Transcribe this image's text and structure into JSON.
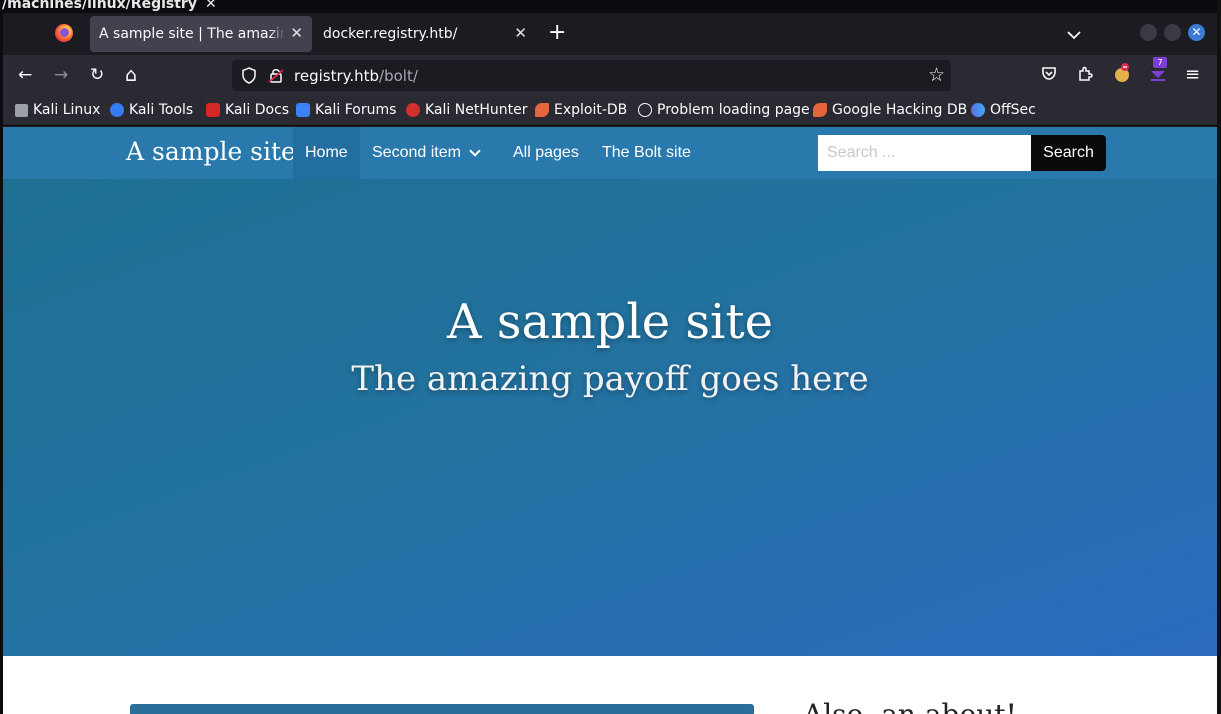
{
  "os": {
    "window_title": "/machines/linux/Registry",
    "close_glyph": "✕"
  },
  "tabs": [
    {
      "label": "A sample site | The amazing payoff goes here",
      "close": "✕",
      "active": true
    },
    {
      "label": "docker.registry.htb/",
      "close": "✕",
      "active": false
    }
  ],
  "tabbar": {
    "new_tab": "+",
    "list_tabs": "⌄"
  },
  "nav": {
    "back": "←",
    "forward": "→",
    "reload": "↻",
    "home": "⌂",
    "url_host": "registry.htb",
    "url_path": "/bolt/",
    "bookmark_star": "☆",
    "pocket": "◡",
    "extensions": "⧉",
    "menu": "≡",
    "ext_badge": "7"
  },
  "bookmarks": [
    {
      "label": "Kali Linux",
      "icon": "kali-dragon-icon",
      "color": "#9aa0a6"
    },
    {
      "label": "Kali Tools",
      "icon": "kali-tools-icon",
      "color": "#367bf0"
    },
    {
      "label": "Kali Docs",
      "icon": "kali-docs-icon",
      "color": "#d72626"
    },
    {
      "label": "Kali Forums",
      "icon": "kali-forums-icon",
      "color": "#3b82f6"
    },
    {
      "label": "Kali NetHunter",
      "icon": "nethunter-icon",
      "color": "#d22f2f"
    },
    {
      "label": "Exploit-DB",
      "icon": "exploit-db-icon",
      "color": "#e4663a"
    },
    {
      "label": "Problem loading page",
      "icon": "globe-icon",
      "color": "#fbfbfe"
    },
    {
      "label": "Google Hacking DB",
      "icon": "ghdb-icon",
      "color": "#e4663a"
    },
    {
      "label": "OffSec",
      "icon": "offsec-icon",
      "color": "#5b6ee1"
    }
  ],
  "site": {
    "brand": "A sample site",
    "menu": [
      "Home",
      "Second item",
      "All pages",
      "The Bolt site"
    ],
    "search_placeholder": "Search ...",
    "search_button": "Search",
    "hero_title": "A sample site",
    "hero_subtitle": "The amazing payoff goes here",
    "aside_title": "Also, an about!"
  }
}
